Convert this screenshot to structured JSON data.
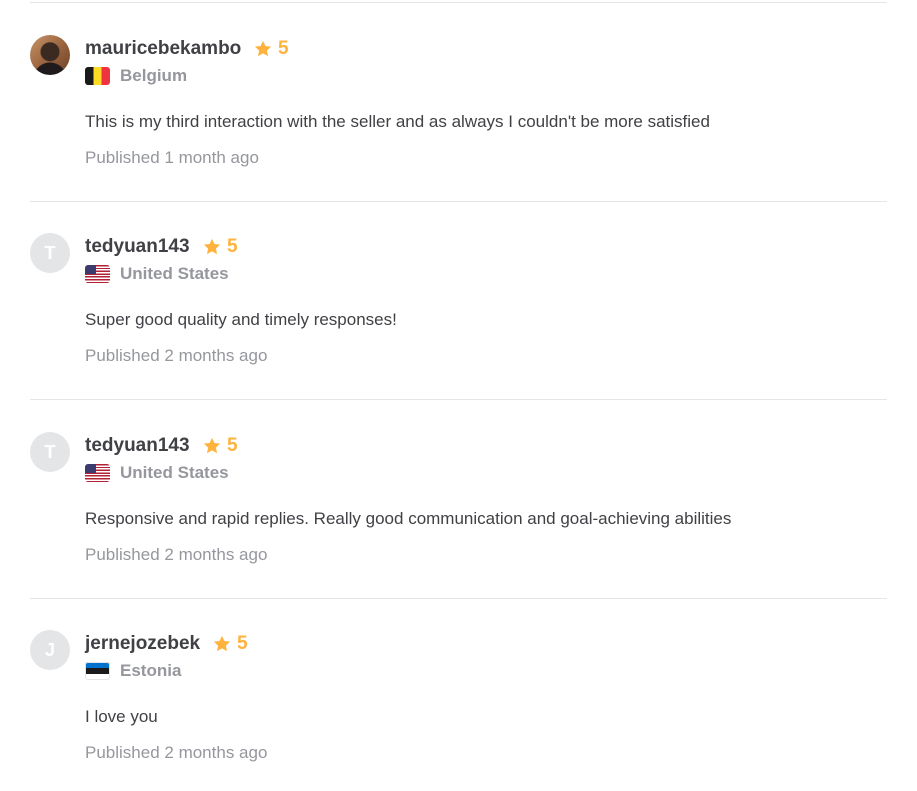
{
  "colors": {
    "star": "#ffb33e",
    "text": "#404145",
    "muted": "#95979d",
    "divider": "#e4e5e7"
  },
  "reviews": [
    {
      "username": "mauricebekambo",
      "avatar_initial": "",
      "rating": "5",
      "country": "Belgium",
      "flag_icon": "belgium-flag-icon",
      "comment": "This is my third interaction with the seller and as always I couldn't be more satisfied",
      "published": "Published 1 month ago"
    },
    {
      "username": "tedyuan143",
      "avatar_initial": "T",
      "rating": "5",
      "country": "United States",
      "flag_icon": "us-flag-icon",
      "comment": "Super good quality and timely responses!",
      "published": "Published 2 months ago"
    },
    {
      "username": "tedyuan143",
      "avatar_initial": "T",
      "rating": "5",
      "country": "United States",
      "flag_icon": "us-flag-icon",
      "comment": "Responsive and rapid replies. Really good communication and goal-achieving abilities",
      "published": "Published 2 months ago"
    },
    {
      "username": "jernejozebek",
      "avatar_initial": "J",
      "rating": "5",
      "country": "Estonia",
      "flag_icon": "estonia-flag-icon",
      "comment": "I love you",
      "published": "Published 2 months ago"
    }
  ]
}
